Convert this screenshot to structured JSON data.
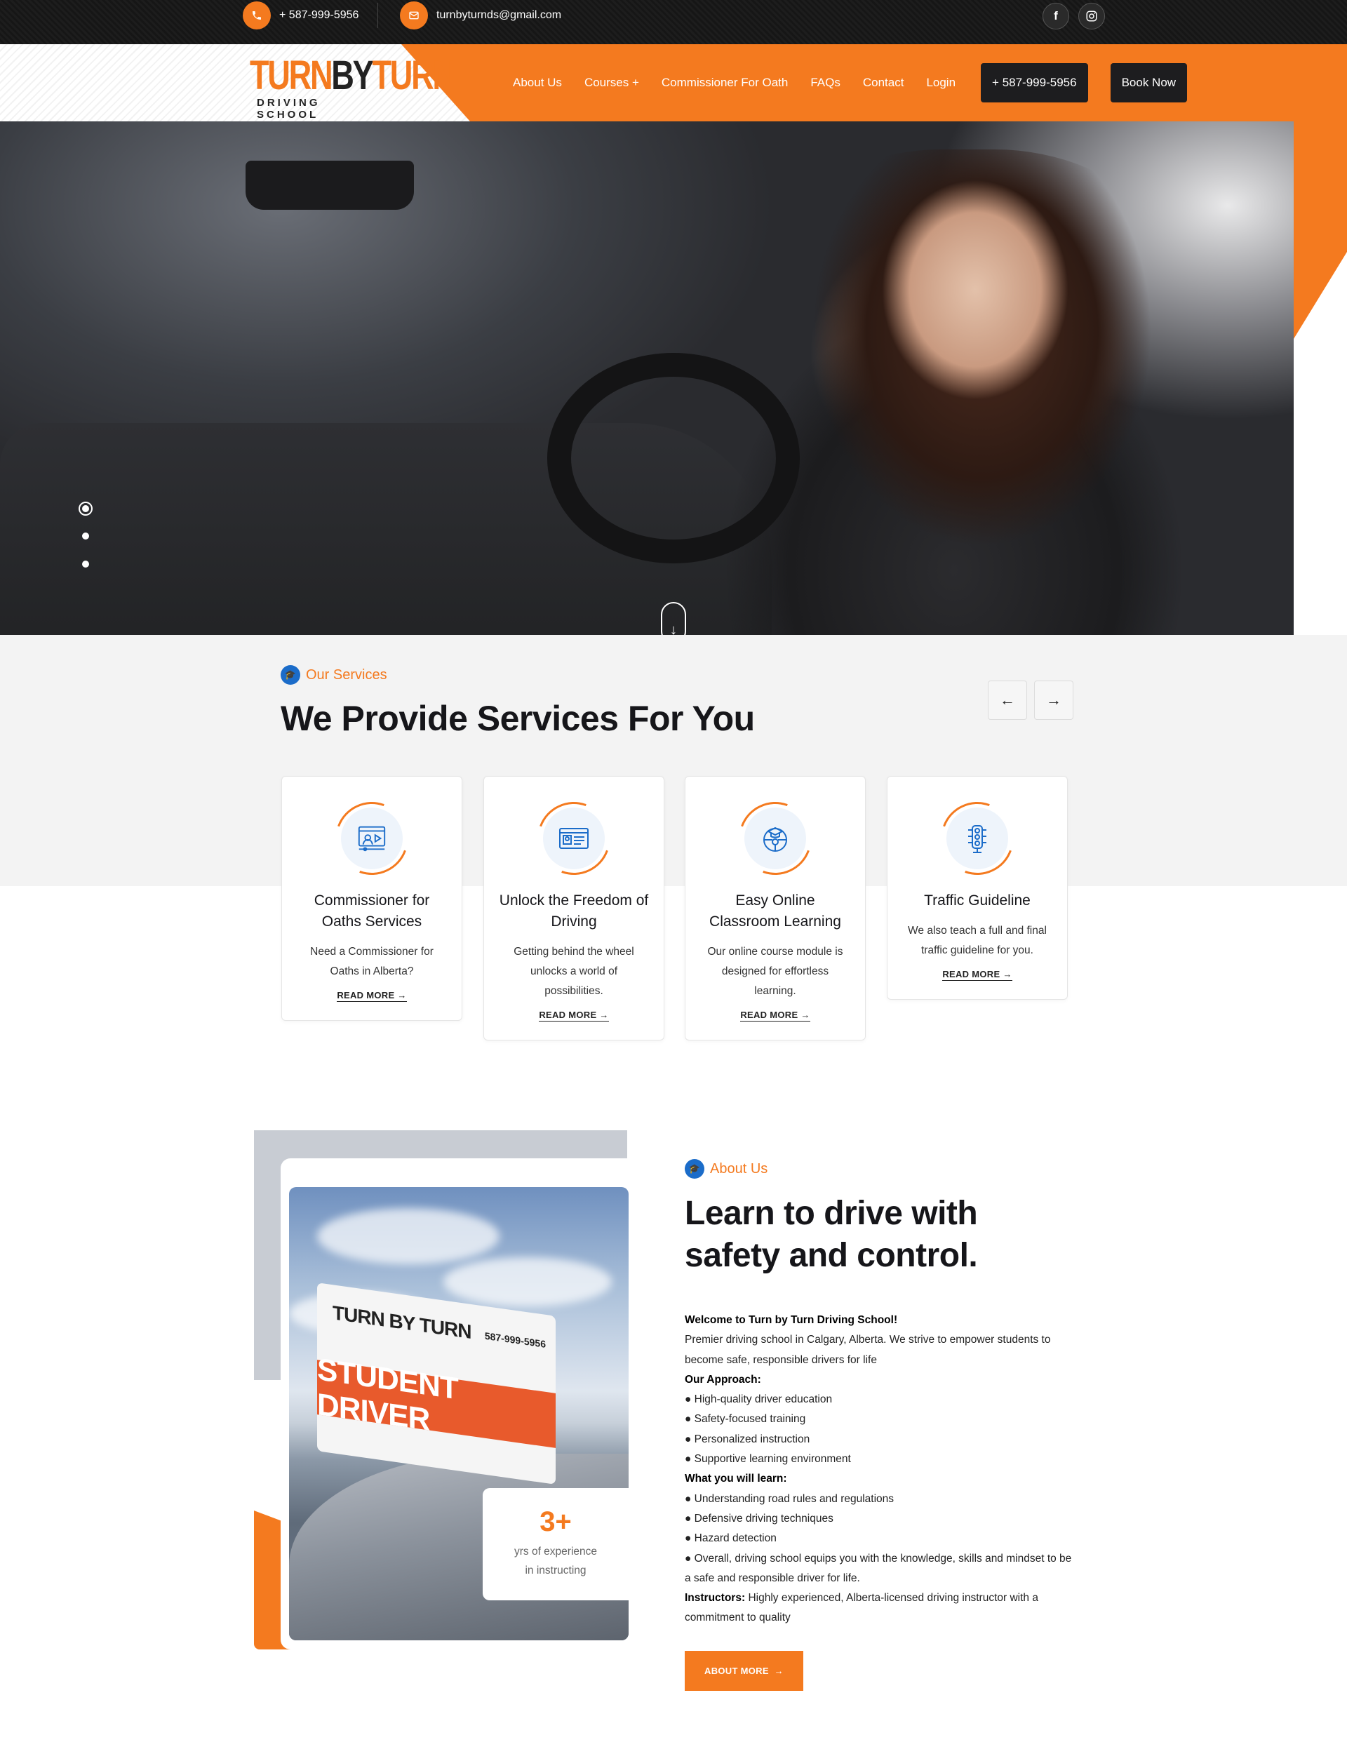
{
  "topbar": {
    "phone": "+ 587-999-5956",
    "email": "turnbyturnds@gmail.com",
    "icons": {
      "phone": "phone-icon",
      "email": "envelope-icon",
      "facebook": "facebook-icon",
      "instagram": "instagram-icon"
    }
  },
  "logo": {
    "word_turn1": "TURN",
    "word_by": "BY",
    "word_turn2": "TURN",
    "subtitle": "DRIVING SCHOOL"
  },
  "nav": {
    "items": [
      "About Us",
      "Courses +",
      "Commissioner For Oath",
      "FAQs",
      "Contact",
      "Login"
    ],
    "phone_button": "+ 587-999-5956",
    "book_button": "Book Now"
  },
  "hero": {
    "slide_count": 3,
    "active_slide": 1,
    "scroll_icon": "arrow-down-icon"
  },
  "services": {
    "eyebrow": "Our Services",
    "title": "We Provide Services For You",
    "cards": [
      {
        "icon": "video-lesson-icon",
        "title": "Commissioner for Oaths Services",
        "text": "Need a Commissioner for Oaths in Alberta?",
        "link": "READ MORE"
      },
      {
        "icon": "license-card-icon",
        "title": "Unlock the Freedom of Driving",
        "text": "Getting behind the wheel unlocks a world of possibilities.",
        "link": "READ MORE"
      },
      {
        "icon": "steering-cap-icon",
        "title": "Easy Online Classroom Learning",
        "text": "Our online course module is designed for effortless learning.",
        "link": "READ MORE"
      },
      {
        "icon": "traffic-light-icon",
        "title": "Traffic Guideline",
        "text": "We also teach a full and final traffic guideline for you.",
        "link": "READ MORE"
      }
    ]
  },
  "about": {
    "eyebrow": "About Us",
    "title_line1": "Learn to drive with",
    "title_line2": "safety and control.",
    "sign": {
      "top": "TURN BY TURN",
      "phone": "587-999-5956",
      "band": "STUDENT DRIVER"
    },
    "stat": {
      "number": "3+",
      "label_line1": "yrs of experience",
      "label_line2": "in instructing"
    },
    "welcome": "Welcome to Turn by Turn Driving School!",
    "intro": "Premier driving school in Calgary, Alberta. We strive to empower students to become safe, responsible drivers for life",
    "approach_heading": "Our Approach:",
    "approach": [
      "High-quality driver education",
      "Safety-focused training",
      "Personalized instruction",
      "Supportive learning environment"
    ],
    "learn_heading": "What you will learn:",
    "learn": [
      "Understanding road rules and regulations",
      "Defensive driving techniques",
      "Hazard detection",
      "Overall, driving school equips you with the knowledge, skills and mindset to be a safe and responsible driver for life."
    ],
    "instructors_label": "Instructors:",
    "instructors_text": "Highly experienced, Alberta-licensed driving instructor with a commitment to quality",
    "button": "ABOUT MORE"
  },
  "colors": {
    "accent": "#f47a1f",
    "dark": "#1d1d1f",
    "icon_blue": "#1b6cc9"
  }
}
